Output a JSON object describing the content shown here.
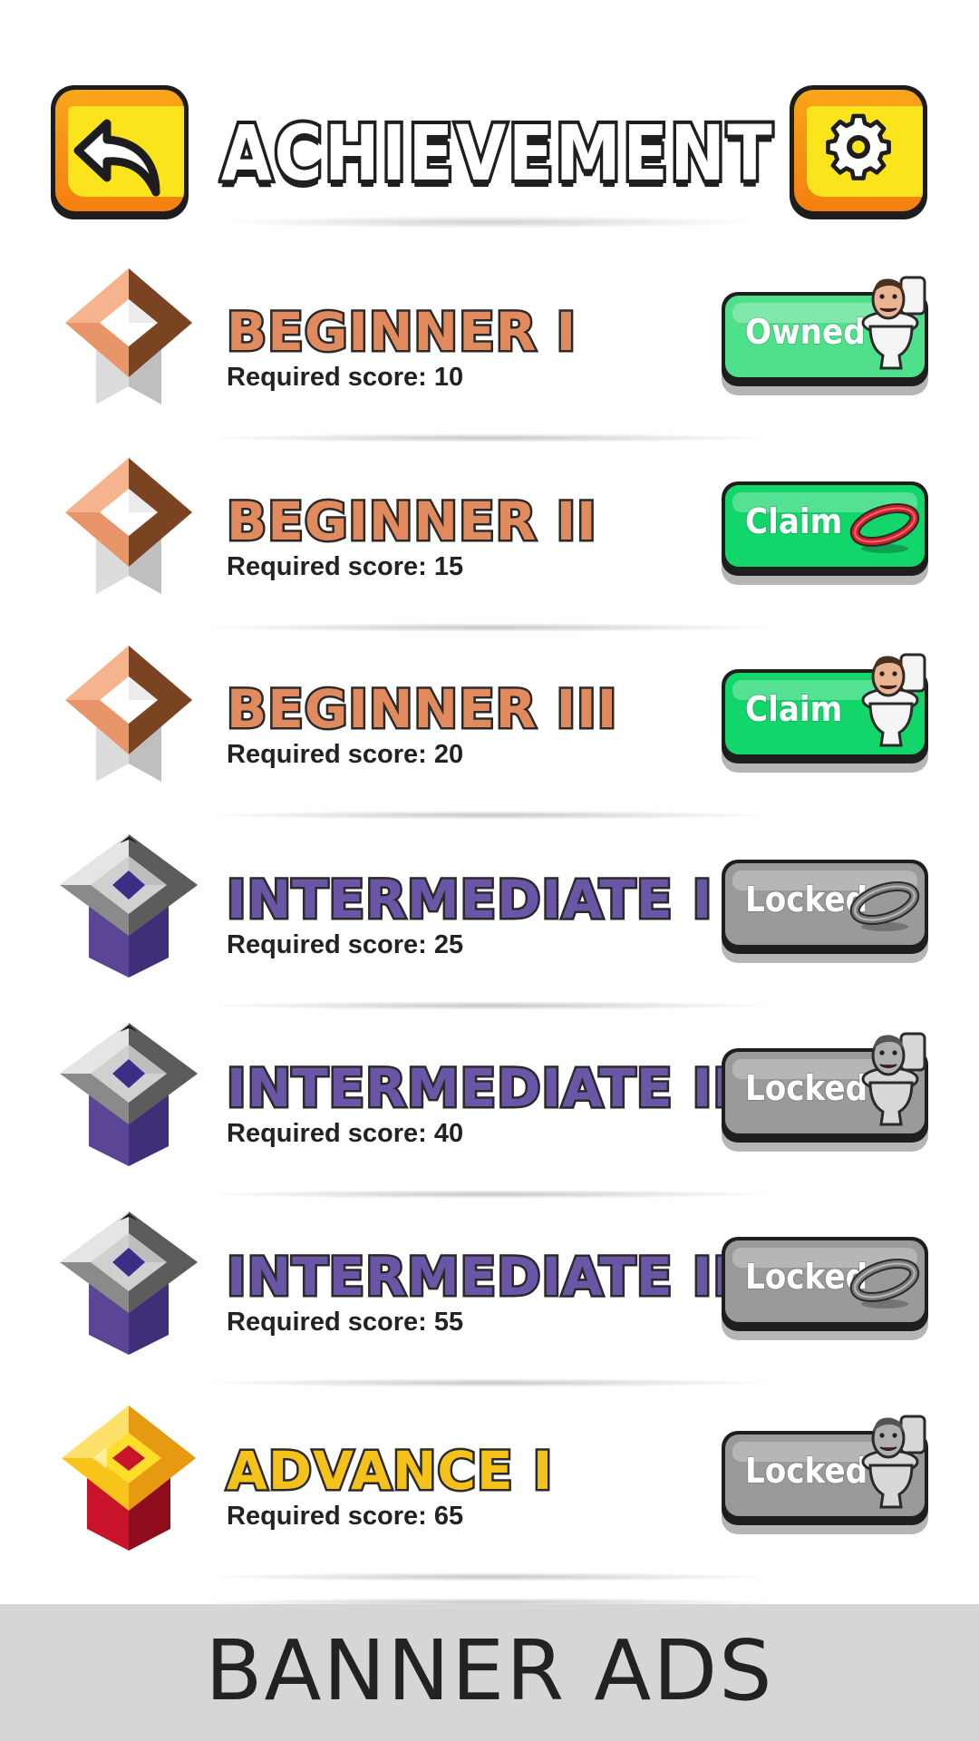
{
  "header": {
    "title": "ACHIEVEMENT",
    "back_icon": "back-arrow-icon",
    "settings_icon": "gear-icon",
    "button_color": "#fbe41c",
    "button_shade": "#f47f10"
  },
  "achievements": [
    {
      "name": "BEGINNER I",
      "required": "Required score: 10",
      "action": "Owned",
      "state": "owned",
      "tier": "beginner",
      "reward_icon": "skibidi-toilet-icon"
    },
    {
      "name": "BEGINNER II",
      "required": "Required score: 15",
      "action": "Claim",
      "state": "claim",
      "tier": "beginner",
      "reward_icon": "ring-icon"
    },
    {
      "name": "BEGINNER III",
      "required": "Required score: 20",
      "action": "Claim",
      "state": "claim",
      "tier": "beginner",
      "reward_icon": "skibidi-toilet-icon"
    },
    {
      "name": "INTERMEDIATE I",
      "required": "Required score: 25",
      "action": "Locked",
      "state": "locked",
      "tier": "intermediate",
      "reward_icon": "ring-icon"
    },
    {
      "name": "INTERMEDIATE II",
      "required": "Required score: 40",
      "action": "Locked",
      "state": "locked",
      "tier": "intermediate",
      "reward_icon": "skibidi-toilet-icon"
    },
    {
      "name": "INTERMEDIATE III",
      "required": "Required score: 55",
      "action": "Locked",
      "state": "locked",
      "tier": "intermediate",
      "reward_icon": "ring-icon"
    },
    {
      "name": "ADVANCE I",
      "required": "Required score: 65",
      "action": "Locked",
      "state": "locked",
      "tier": "advance",
      "reward_icon": "skibidi-toilet-icon"
    }
  ],
  "tier_colors": {
    "beginner": "#e08a5e",
    "intermediate": "#6b55a6",
    "advance": "#f5c21b"
  },
  "banner": {
    "text": "BANNER ADS"
  }
}
